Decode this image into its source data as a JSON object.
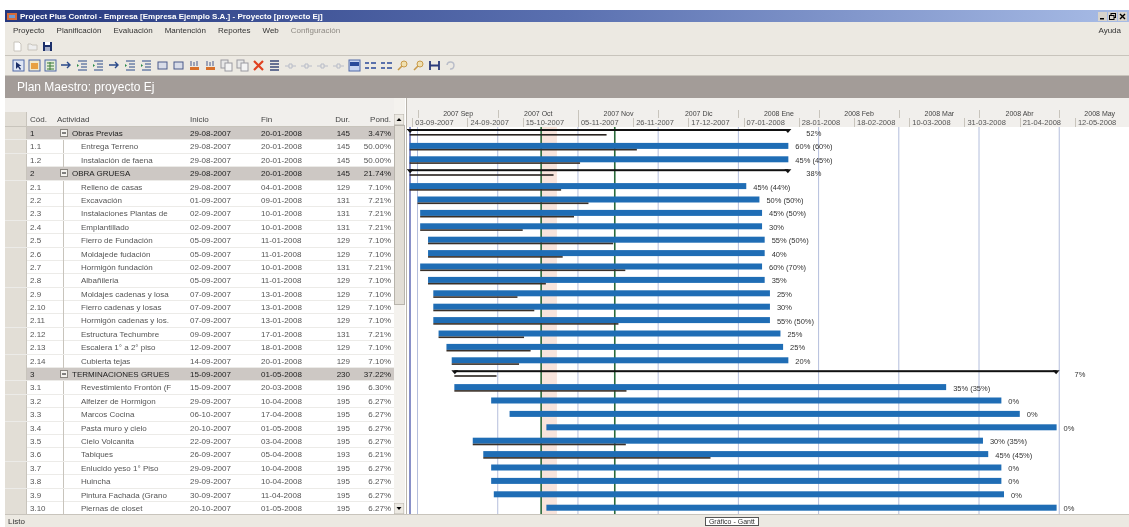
{
  "window": {
    "title": "Project Plus Control - Empresa [Empresa Ejemplo S.A.] - Proyecto [proyecto Ej]"
  },
  "menu": [
    {
      "label": "Proyecto",
      "disabled": false
    },
    {
      "label": "Planificación",
      "disabled": false
    },
    {
      "label": "Evaluación",
      "disabled": false
    },
    {
      "label": "Mantención",
      "disabled": false
    },
    {
      "label": "Reportes",
      "disabled": false
    },
    {
      "label": "Web",
      "disabled": false
    },
    {
      "label": "Configuración",
      "disabled": true
    }
  ],
  "help_menu": "Ayuda",
  "plan_header": "Plan Maestro: proyecto Ej",
  "table": {
    "columns": [
      "Cód.",
      "Actividad",
      "Inicio",
      "Fin",
      "Dur.",
      "Pond."
    ]
  },
  "tasks": [
    {
      "code": "1",
      "activity": "Obras Previas",
      "start": "29-08-2007",
      "end": "20-01-2008",
      "duration": "145",
      "weight": "3.47%",
      "level": 0.52,
      "bar_label": "52%",
      "expanded": true,
      "children": [
        {
          "code": "1.1",
          "activity": "Entrega Terreno",
          "start": "29-08-2007",
          "end": "20-01-2008",
          "duration": "145",
          "weight": "50.00%",
          "level": 0.6,
          "bar_label": "60% (60%)"
        },
        {
          "code": "1.2",
          "activity": "Instalación de faena",
          "start": "29-08-2007",
          "end": "20-01-2008",
          "duration": "145",
          "weight": "50.00%",
          "level": 0.45,
          "bar_label": "45% (45%)"
        }
      ]
    },
    {
      "code": "2",
      "activity": "OBRA GRUESA",
      "start": "29-08-2007",
      "end": "20-01-2008",
      "duration": "145",
      "weight": "21.74%",
      "level": 0.38,
      "bar_label": "38%",
      "expanded": true,
      "children": [
        {
          "code": "2.1",
          "activity": "Relleno de casas",
          "start": "29-08-2007",
          "end": "04-01-2008",
          "duration": "129",
          "weight": "7.10%",
          "level": 0.45,
          "bar_label": "45% (44%)"
        },
        {
          "code": "2.2",
          "activity": "Excavación",
          "start": "01-09-2007",
          "end": "09-01-2008",
          "duration": "131",
          "weight": "7.21%",
          "level": 0.5,
          "bar_label": "50% (50%)"
        },
        {
          "code": "2.3",
          "activity": "Instalaciones Plantas de",
          "start": "02-09-2007",
          "end": "10-01-2008",
          "duration": "131",
          "weight": "7.21%",
          "level": 0.45,
          "bar_label": "45% (50%)"
        },
        {
          "code": "2.4",
          "activity": "Emplantillado",
          "start": "02-09-2007",
          "end": "10-01-2008",
          "duration": "131",
          "weight": "7.21%",
          "level": 0.3,
          "bar_label": "30%"
        },
        {
          "code": "2.5",
          "activity": "Fierro de Fundación",
          "start": "05-09-2007",
          "end": "11-01-2008",
          "duration": "129",
          "weight": "7.10%",
          "level": 0.55,
          "bar_label": "55% (50%)"
        },
        {
          "code": "2.6",
          "activity": "Moldajede fudación",
          "start": "05-09-2007",
          "end": "11-01-2008",
          "duration": "129",
          "weight": "7.10%",
          "level": 0.4,
          "bar_label": "40%"
        },
        {
          "code": "2.7",
          "activity": "Hormigón fundación",
          "start": "02-09-2007",
          "end": "10-01-2008",
          "duration": "131",
          "weight": "7.21%",
          "level": 0.6,
          "bar_label": "60% (70%)"
        },
        {
          "code": "2.8",
          "activity": "Albañileria",
          "start": "05-09-2007",
          "end": "11-01-2008",
          "duration": "129",
          "weight": "7.10%",
          "level": 0.35,
          "bar_label": "35%"
        },
        {
          "code": "2.9",
          "activity": "Moldajes cadenas y losa",
          "start": "07-09-2007",
          "end": "13-01-2008",
          "duration": "129",
          "weight": "7.10%",
          "level": 0.25,
          "bar_label": "25%"
        },
        {
          "code": "2.10",
          "activity": "Fierro cadenas y losas",
          "start": "07-09-2007",
          "end": "13-01-2008",
          "duration": "129",
          "weight": "7.10%",
          "level": 0.3,
          "bar_label": "30%"
        },
        {
          "code": "2.11",
          "activity": "Hormigón cadenas y los.",
          "start": "07-09-2007",
          "end": "13-01-2008",
          "duration": "129",
          "weight": "7.10%",
          "level": 0.55,
          "bar_label": "55% (50%)"
        },
        {
          "code": "2.12",
          "activity": "Estructura Techumbre",
          "start": "09-09-2007",
          "end": "17-01-2008",
          "duration": "131",
          "weight": "7.21%",
          "level": 0.25,
          "bar_label": "25%"
        },
        {
          "code": "2.13",
          "activity": "Escalera 1° a 2° piso",
          "start": "12-09-2007",
          "end": "18-01-2008",
          "duration": "129",
          "weight": "7.10%",
          "level": 0.25,
          "bar_label": "25%"
        },
        {
          "code": "2.14",
          "activity": "Cubierta tejas",
          "start": "14-09-2007",
          "end": "20-01-2008",
          "duration": "129",
          "weight": "7.10%",
          "level": 0.2,
          "bar_label": "20%"
        }
      ]
    },
    {
      "code": "3",
      "activity": "TERMINACIONES GRUES",
      "start": "15-09-2007",
      "end": "01-05-2008",
      "duration": "230",
      "weight": "37.22%",
      "level": 0.07,
      "bar_label": "7%",
      "expanded": true,
      "children": [
        {
          "code": "3.1",
          "activity": "Revestimiento Frontón (F",
          "start": "15-09-2007",
          "end": "20-03-2008",
          "duration": "196",
          "weight": "6.30%",
          "level": 0.35,
          "bar_label": "35% (35%)"
        },
        {
          "code": "3.2",
          "activity": "Alfeizer de Hormigon",
          "start": "29-09-2007",
          "end": "10-04-2008",
          "duration": "195",
          "weight": "6.27%",
          "bar_label": "0%"
        },
        {
          "code": "3.3",
          "activity": "Marcos Cocina",
          "start": "06-10-2007",
          "end": "17-04-2008",
          "duration": "195",
          "weight": "6.27%",
          "bar_label": "0%"
        },
        {
          "code": "3.4",
          "activity": "Pasta muro y cielo",
          "start": "20-10-2007",
          "end": "01-05-2008",
          "duration": "195",
          "weight": "6.27%",
          "bar_label": "0%"
        },
        {
          "code": "3.5",
          "activity": "Cielo Volcanita",
          "start": "22-09-2007",
          "end": "03-04-2008",
          "duration": "195",
          "weight": "6.27%",
          "level": 0.3,
          "bar_label": "30% (35%)"
        },
        {
          "code": "3.6",
          "activity": "Tabiques",
          "start": "26-09-2007",
          "end": "05-04-2008",
          "duration": "193",
          "weight": "6.21%",
          "level": 0.45,
          "bar_label": "45% (45%)"
        },
        {
          "code": "3.7",
          "activity": "Enlucido yeso 1° Piso",
          "start": "29-09-2007",
          "end": "10-04-2008",
          "duration": "195",
          "weight": "6.27%",
          "bar_label": "0%"
        },
        {
          "code": "3.8",
          "activity": "Huincha",
          "start": "29-09-2007",
          "end": "10-04-2008",
          "duration": "195",
          "weight": "6.27%",
          "bar_label": "0%"
        },
        {
          "code": "3.9",
          "activity": "Pintura Fachada (Grano",
          "start": "30-09-2007",
          "end": "11-04-2008",
          "duration": "195",
          "weight": "6.27%",
          "bar_label": "0%"
        },
        {
          "code": "3.10",
          "activity": "Piernas de closet",
          "start": "20-10-2007",
          "end": "01-05-2008",
          "duration": "195",
          "weight": "6.27%",
          "bar_label": "0%"
        }
      ]
    }
  ],
  "timeline": {
    "months": [
      "2007 Sep",
      "2007 Oct",
      "2007 Nov",
      "2007 Dic",
      "2008 Ene",
      "2008 Feb",
      "2008 Mar",
      "2008 Abr",
      "2008 May"
    ],
    "weeks": [
      "03-09-2007",
      "24-09-2007",
      "15-10-2007",
      "05-11-2007",
      "26-11-2007",
      "17-12-2007",
      "07-01-2008",
      "28-01-2008",
      "18-02-2008",
      "10-03-2008",
      "31-03-2008",
      "21-04-2008",
      "12-05-2008"
    ]
  },
  "status_bar": {
    "text": "Listo",
    "view_label": "Gráfico - Gantt"
  }
}
